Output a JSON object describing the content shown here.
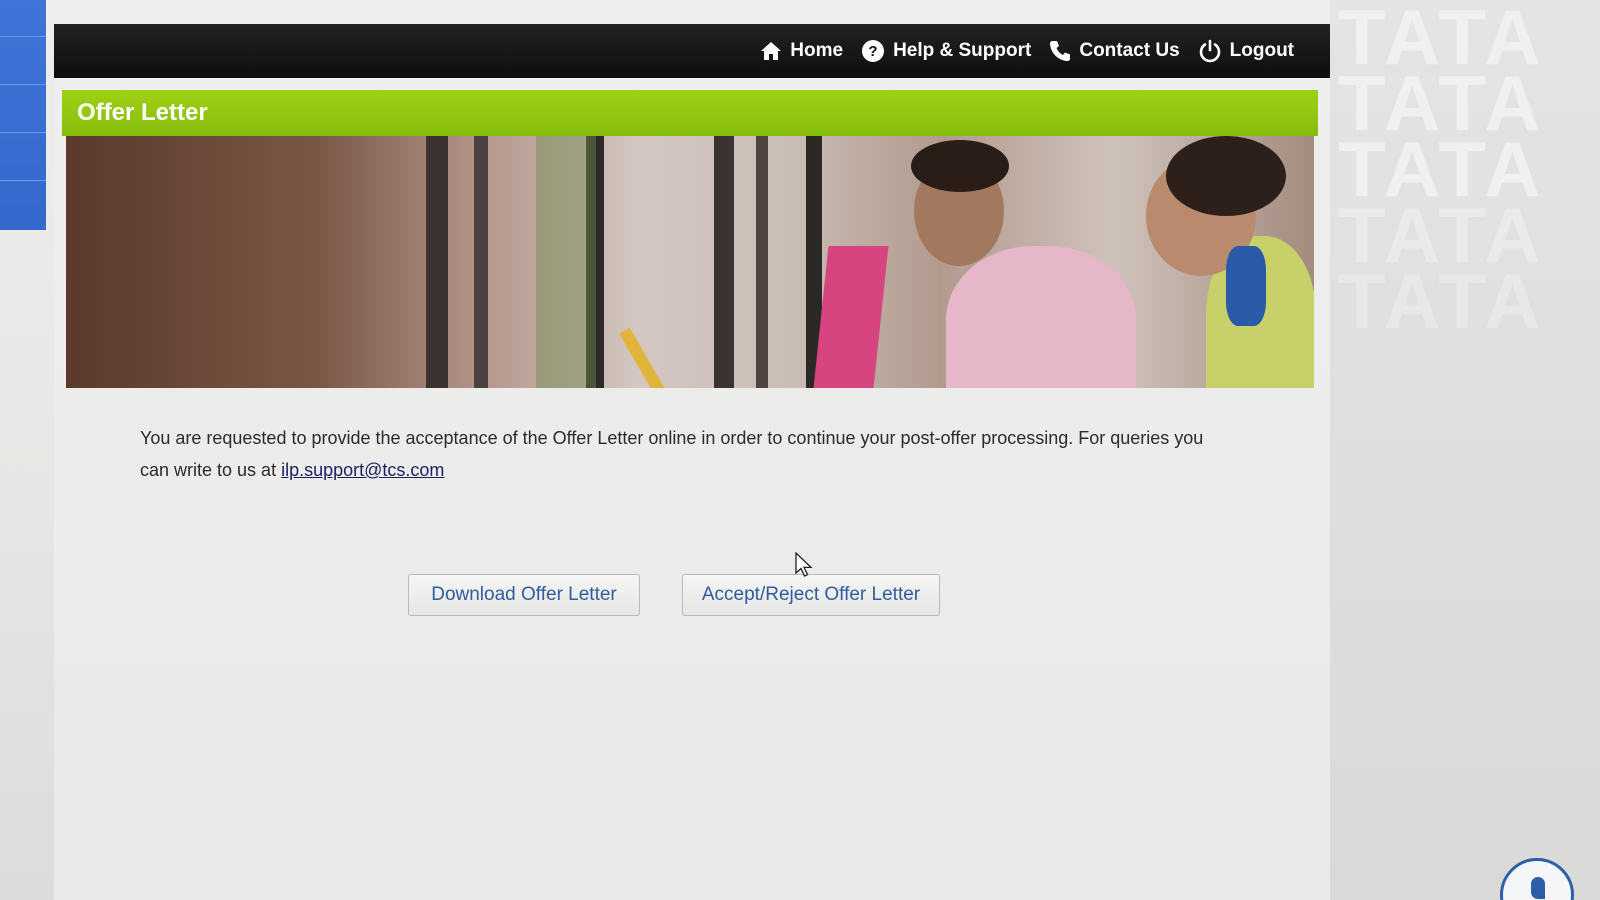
{
  "nav": {
    "items": [
      {
        "label": "Home",
        "icon": "home-icon"
      },
      {
        "label": "Help & Support",
        "icon": "help-icon"
      },
      {
        "label": "Contact Us",
        "icon": "phone-icon"
      },
      {
        "label": "Logout",
        "icon": "power-icon"
      }
    ]
  },
  "page": {
    "title": "Offer Letter",
    "message": "You are requested to provide the acceptance of the Offer Letter online in order to continue your post-offer processing. For queries you can write to us at ",
    "support_email": "ilp.support@tcs.com"
  },
  "actions": {
    "download_label": "Download Offer Letter",
    "accept_reject_label": "Accept/Reject Offer Letter"
  },
  "colors": {
    "nav_bg": "#111111",
    "header_green": "#8fc410",
    "button_text": "#2f5d9f",
    "sidebar_blue": "#3a6fd4"
  },
  "watermark": {
    "text": "TATA"
  }
}
